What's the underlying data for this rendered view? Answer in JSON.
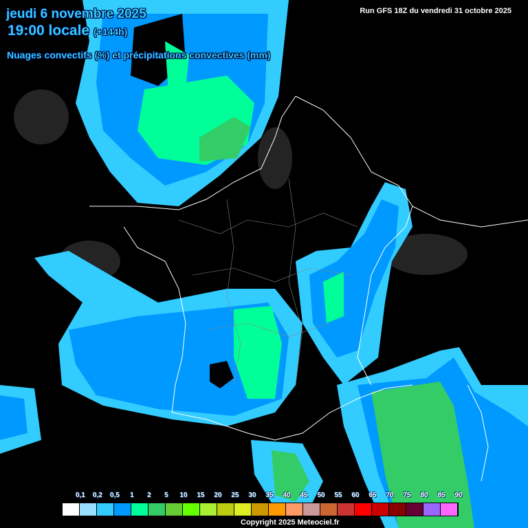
{
  "header": {
    "date": "jeudi 6 novembre 2025",
    "time": "19:00 locale",
    "lead": "(+144h)",
    "variable": "Nuages convectifs (%) et précipitations convectives (mm)",
    "run": "Run GFS 18Z du vendredi 31 octobre 2025"
  },
  "legend": {
    "labels": [
      "0,1",
      "0,2",
      "0,5",
      "1",
      "2",
      "5",
      "10",
      "15",
      "20",
      "25",
      "30",
      "35",
      "40",
      "45",
      "50",
      "55",
      "60",
      "65",
      "70",
      "75",
      "80",
      "85",
      "90"
    ],
    "colors": [
      "#ffffff",
      "#99e0ff",
      "#33ccff",
      "#0099ff",
      "#00ff99",
      "#33cc66",
      "#66cc33",
      "#66ff00",
      "#aaee33",
      "#bbcc11",
      "#ddee22",
      "#cc9900",
      "#ff9900",
      "#ff9966",
      "#cc9999",
      "#cc6633",
      "#cc3333",
      "#ff0000",
      "#cc0000",
      "#880000",
      "#660033",
      "#9966ff",
      "#ff66ff"
    ]
  },
  "colors": {
    "light": "#33ccff",
    "mid": "#0099ff",
    "green": "#00ff99",
    "dgreen": "#33cc66"
  },
  "footer": {
    "copyright": "Copyright 2025 Meteociel.fr"
  }
}
